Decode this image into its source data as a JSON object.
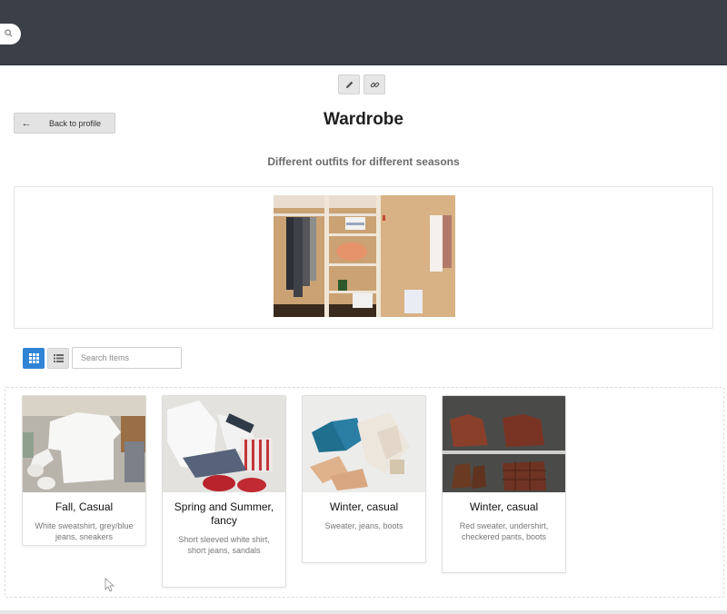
{
  "header": {
    "search_icon": "search-icon"
  },
  "toolbar": {
    "edit_icon": "pencil-icon",
    "link_icon": "link-icon"
  },
  "back_button": {
    "label": "Back to profile",
    "icon": "arrow-left-icon"
  },
  "page": {
    "title": "Wardrobe",
    "subtitle": "Different outfits for different seasons"
  },
  "view_controls": {
    "grid_icon": "grid-icon",
    "list_icon": "list-icon",
    "active": "grid"
  },
  "search": {
    "placeholder": "Search Items",
    "value": ""
  },
  "items": [
    {
      "title": "Fall, Casual",
      "description": "White sweatshirt, grey/blue jeans, sneakers"
    },
    {
      "title": "Spring and Summer, fancy",
      "description": "Short sleeved white shirt, short jeans, sandals"
    },
    {
      "title": "Winter, casual",
      "description": "Sweater, jeans, boots"
    },
    {
      "title": "Winter, casual",
      "description": "Red sweater, undershirt, checkered pants, boots"
    }
  ],
  "colors": {
    "topbar": "#3b4048",
    "accent": "#2f84d6"
  }
}
